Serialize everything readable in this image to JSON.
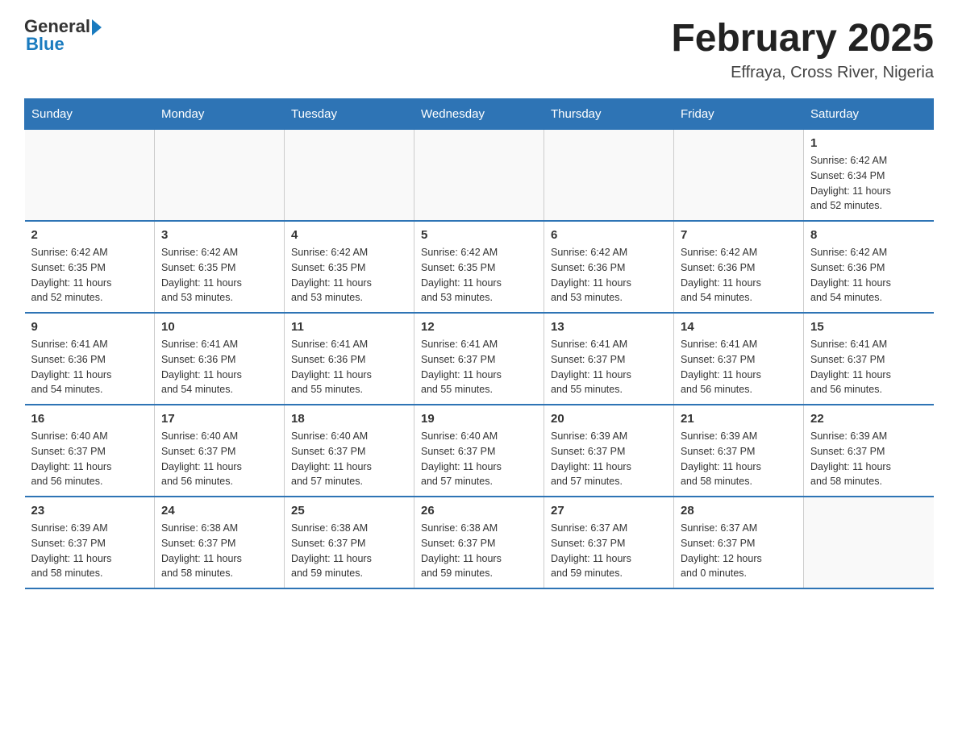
{
  "logo": {
    "general": "General",
    "blue": "Blue"
  },
  "title": "February 2025",
  "subtitle": "Effraya, Cross River, Nigeria",
  "weekdays": [
    "Sunday",
    "Monday",
    "Tuesday",
    "Wednesday",
    "Thursday",
    "Friday",
    "Saturday"
  ],
  "weeks": [
    [
      {
        "day": "",
        "info": ""
      },
      {
        "day": "",
        "info": ""
      },
      {
        "day": "",
        "info": ""
      },
      {
        "day": "",
        "info": ""
      },
      {
        "day": "",
        "info": ""
      },
      {
        "day": "",
        "info": ""
      },
      {
        "day": "1",
        "info": "Sunrise: 6:42 AM\nSunset: 6:34 PM\nDaylight: 11 hours\nand 52 minutes."
      }
    ],
    [
      {
        "day": "2",
        "info": "Sunrise: 6:42 AM\nSunset: 6:35 PM\nDaylight: 11 hours\nand 52 minutes."
      },
      {
        "day": "3",
        "info": "Sunrise: 6:42 AM\nSunset: 6:35 PM\nDaylight: 11 hours\nand 53 minutes."
      },
      {
        "day": "4",
        "info": "Sunrise: 6:42 AM\nSunset: 6:35 PM\nDaylight: 11 hours\nand 53 minutes."
      },
      {
        "day": "5",
        "info": "Sunrise: 6:42 AM\nSunset: 6:35 PM\nDaylight: 11 hours\nand 53 minutes."
      },
      {
        "day": "6",
        "info": "Sunrise: 6:42 AM\nSunset: 6:36 PM\nDaylight: 11 hours\nand 53 minutes."
      },
      {
        "day": "7",
        "info": "Sunrise: 6:42 AM\nSunset: 6:36 PM\nDaylight: 11 hours\nand 54 minutes."
      },
      {
        "day": "8",
        "info": "Sunrise: 6:42 AM\nSunset: 6:36 PM\nDaylight: 11 hours\nand 54 minutes."
      }
    ],
    [
      {
        "day": "9",
        "info": "Sunrise: 6:41 AM\nSunset: 6:36 PM\nDaylight: 11 hours\nand 54 minutes."
      },
      {
        "day": "10",
        "info": "Sunrise: 6:41 AM\nSunset: 6:36 PM\nDaylight: 11 hours\nand 54 minutes."
      },
      {
        "day": "11",
        "info": "Sunrise: 6:41 AM\nSunset: 6:36 PM\nDaylight: 11 hours\nand 55 minutes."
      },
      {
        "day": "12",
        "info": "Sunrise: 6:41 AM\nSunset: 6:37 PM\nDaylight: 11 hours\nand 55 minutes."
      },
      {
        "day": "13",
        "info": "Sunrise: 6:41 AM\nSunset: 6:37 PM\nDaylight: 11 hours\nand 55 minutes."
      },
      {
        "day": "14",
        "info": "Sunrise: 6:41 AM\nSunset: 6:37 PM\nDaylight: 11 hours\nand 56 minutes."
      },
      {
        "day": "15",
        "info": "Sunrise: 6:41 AM\nSunset: 6:37 PM\nDaylight: 11 hours\nand 56 minutes."
      }
    ],
    [
      {
        "day": "16",
        "info": "Sunrise: 6:40 AM\nSunset: 6:37 PM\nDaylight: 11 hours\nand 56 minutes."
      },
      {
        "day": "17",
        "info": "Sunrise: 6:40 AM\nSunset: 6:37 PM\nDaylight: 11 hours\nand 56 minutes."
      },
      {
        "day": "18",
        "info": "Sunrise: 6:40 AM\nSunset: 6:37 PM\nDaylight: 11 hours\nand 57 minutes."
      },
      {
        "day": "19",
        "info": "Sunrise: 6:40 AM\nSunset: 6:37 PM\nDaylight: 11 hours\nand 57 minutes."
      },
      {
        "day": "20",
        "info": "Sunrise: 6:39 AM\nSunset: 6:37 PM\nDaylight: 11 hours\nand 57 minutes."
      },
      {
        "day": "21",
        "info": "Sunrise: 6:39 AM\nSunset: 6:37 PM\nDaylight: 11 hours\nand 58 minutes."
      },
      {
        "day": "22",
        "info": "Sunrise: 6:39 AM\nSunset: 6:37 PM\nDaylight: 11 hours\nand 58 minutes."
      }
    ],
    [
      {
        "day": "23",
        "info": "Sunrise: 6:39 AM\nSunset: 6:37 PM\nDaylight: 11 hours\nand 58 minutes."
      },
      {
        "day": "24",
        "info": "Sunrise: 6:38 AM\nSunset: 6:37 PM\nDaylight: 11 hours\nand 58 minutes."
      },
      {
        "day": "25",
        "info": "Sunrise: 6:38 AM\nSunset: 6:37 PM\nDaylight: 11 hours\nand 59 minutes."
      },
      {
        "day": "26",
        "info": "Sunrise: 6:38 AM\nSunset: 6:37 PM\nDaylight: 11 hours\nand 59 minutes."
      },
      {
        "day": "27",
        "info": "Sunrise: 6:37 AM\nSunset: 6:37 PM\nDaylight: 11 hours\nand 59 minutes."
      },
      {
        "day": "28",
        "info": "Sunrise: 6:37 AM\nSunset: 6:37 PM\nDaylight: 12 hours\nand 0 minutes."
      },
      {
        "day": "",
        "info": ""
      }
    ]
  ]
}
